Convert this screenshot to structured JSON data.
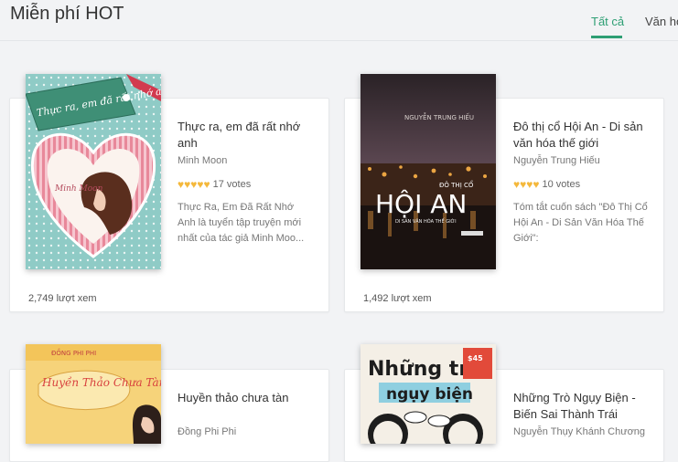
{
  "section": {
    "title": "Miễn phí HOT"
  },
  "tabs": [
    {
      "label": "Tất cả",
      "active": true
    },
    {
      "label": "Văn họ",
      "active": false
    }
  ],
  "books": [
    {
      "title": "Thực ra, em đã rất nhớ anh",
      "author": "Minh Moon",
      "rating": 5,
      "votes": "17 votes",
      "description": "Thực Ra, Em Đã Rất Nhớ Anh là tuyển tập truyện mới nhất của tác giả Minh Moo...",
      "views": "2,749 lượt xem",
      "cover_text": "Thực ra, em đã rất nhớ anh",
      "cover_author": "Minh Moon"
    },
    {
      "title": "Đô thị cổ Hội An - Di sản văn hóa thế giới",
      "author": "Nguyễn Trung Hiếu",
      "rating": 4,
      "votes": "10 votes",
      "description": "Tóm tắt cuốn sách \"Đô Thị Cổ Hội An - Di Sản Văn Hóa Thế Giới\":",
      "views": "1,492 lượt xem",
      "cover_author": "NGUYỄN TRUNG HIẾU",
      "cover_small": "ĐÔ THỊ CỔ",
      "cover_big": "HỘI AN",
      "cover_sub": "DI SẢN VĂN HÓA THẾ GIỚI"
    },
    {
      "title": "Huyền thảo chưa tàn",
      "author": "Đồng Phi Phi",
      "cover_author": "ĐỒNG PHI PHI",
      "cover_text": "Huyền Thảo Chưa Tàn"
    },
    {
      "title": "Những Trò Ngụy Biện - Biến Sai Thành Trái",
      "author": "Nguyễn Thụy Khánh Chương",
      "cover_line1": "Những trò",
      "cover_line2": "ngụy biện",
      "cover_badge": "$45"
    }
  ],
  "colors": {
    "accent": "#2e9f74",
    "heart": "#f4b83b"
  }
}
